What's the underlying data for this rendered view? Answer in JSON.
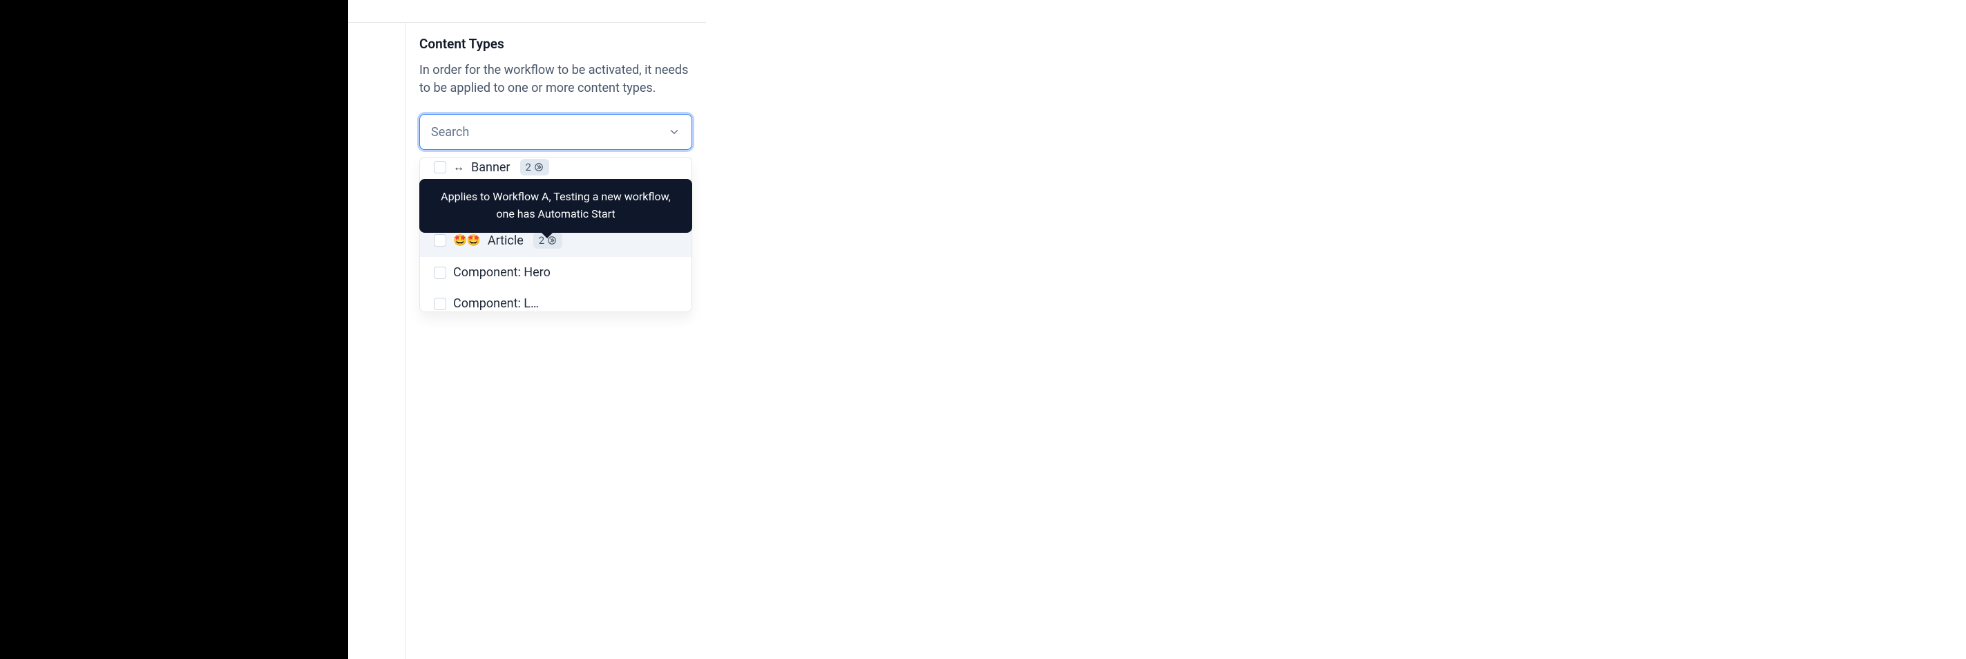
{
  "section": {
    "title": "Content Types",
    "description": "In order for the workflow to be activated, it needs to be applied to one or more content types."
  },
  "search": {
    "placeholder": "Search"
  },
  "tooltip": {
    "text": "Applies to Workflow A, Testing a new workflow, one has Automatic Start"
  },
  "options": [
    {
      "emoji": "↔",
      "label": "Banner",
      "badge_count": "2",
      "has_badge": true
    },
    {
      "emoji": "🤩🤩",
      "label": "Article",
      "badge_count": "2",
      "has_badge": true
    },
    {
      "emoji": "",
      "label": "Component: Hero",
      "badge_count": "",
      "has_badge": false
    },
    {
      "emoji": "",
      "label": "Component: L…",
      "badge_count": "",
      "has_badge": false
    }
  ]
}
